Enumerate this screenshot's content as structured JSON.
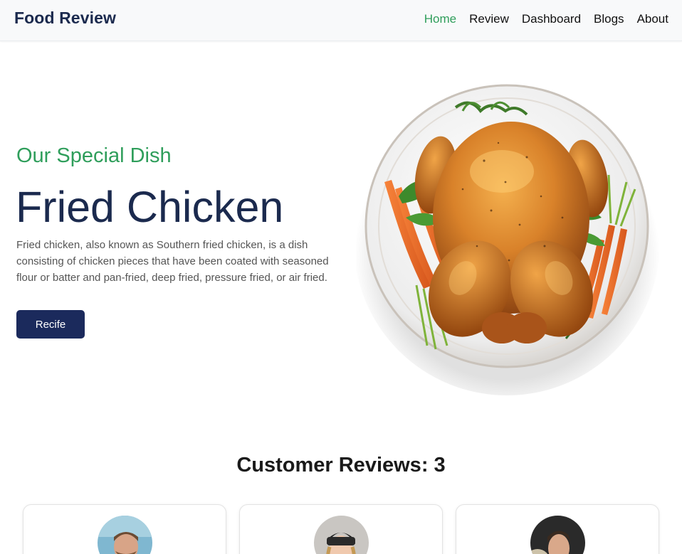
{
  "nav": {
    "brand": "Food Review",
    "links": [
      {
        "label": "Home",
        "active": true
      },
      {
        "label": "Review",
        "active": false
      },
      {
        "label": "Dashboard",
        "active": false
      },
      {
        "label": "Blogs",
        "active": false
      },
      {
        "label": "About",
        "active": false
      }
    ]
  },
  "hero": {
    "kicker": "Our Special Dish",
    "title": "Fried Chicken",
    "description": "Fried chicken, also known as Southern fried chicken, is a dish consisting of chicken pieces that have been coated with seasoned flour or batter and pan-fried, deep fried, pressure fried, or air fried.",
    "button_label": "Recife"
  },
  "reviews": {
    "heading": "Customer Reviews: 3",
    "cards": [
      {
        "avatar": "bearded-man-avatar"
      },
      {
        "avatar": "woman-in-beanie-avatar"
      },
      {
        "avatar": "young-man-avatar"
      }
    ]
  },
  "colors": {
    "brand": "#1b2a4e",
    "accent": "#2f9e5b",
    "button": "#1b2a5c"
  }
}
